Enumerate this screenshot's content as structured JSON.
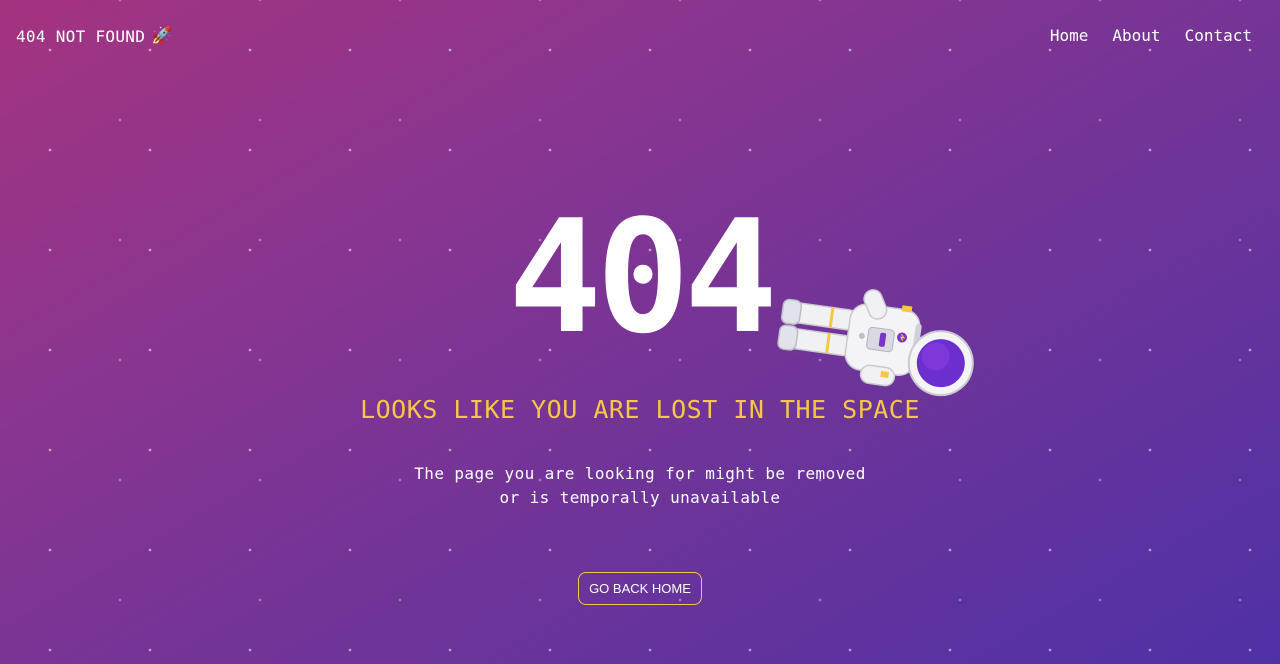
{
  "header": {
    "brand": "404 NOT FOUND",
    "brand_icon": "rocket-icon",
    "brand_icon_glyph": "🚀",
    "nav": [
      {
        "label": "Home"
      },
      {
        "label": "About"
      },
      {
        "label": "Contact"
      }
    ]
  },
  "main": {
    "code": "404",
    "headline": "LOOKS LIKE YOU ARE LOST IN THE SPACE",
    "subtext_line1": "The page you are looking for might be removed",
    "subtext_line2": "or is temporally unavailable",
    "button_label": "GO BACK HOME",
    "illustration": "astronaut"
  },
  "colors": {
    "gradient_start": "#a4337f",
    "gradient_end": "#4f31a6",
    "accent_yellow": "#f6c744",
    "text": "#ffffff"
  }
}
